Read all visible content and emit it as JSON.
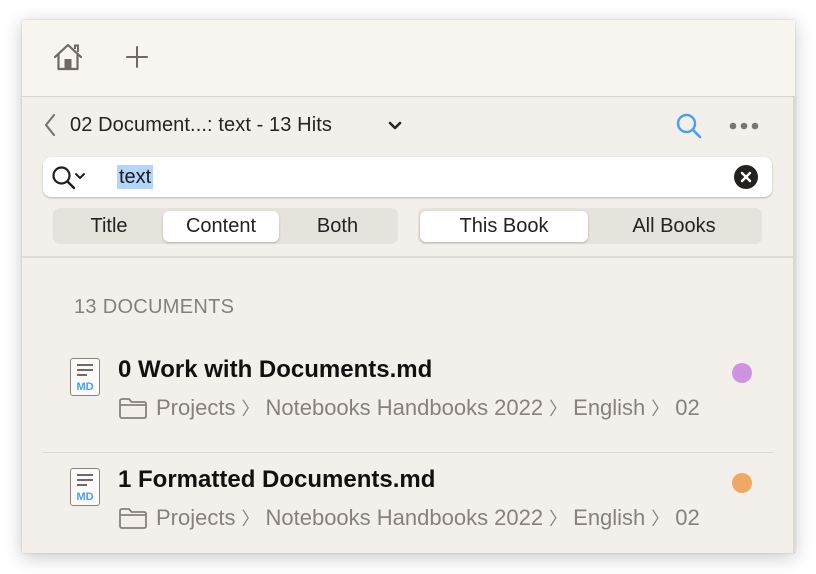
{
  "toolbar": {
    "home_icon": "home-icon",
    "add_icon": "plus-icon"
  },
  "nav": {
    "back_icon": "chevron-left-icon",
    "title": "02 Document...: text - 13 Hits",
    "dropdown_icon": "chevron-down-icon",
    "search_icon": "search-icon",
    "more_icon": "ellipsis-icon"
  },
  "search": {
    "value": "text",
    "placeholder": "",
    "scope_icon": "search-options-icon",
    "clear_icon": "clear-circle-icon"
  },
  "filters": {
    "field": {
      "options": [
        "Title",
        "Content",
        "Both"
      ],
      "selected": "Content"
    },
    "scope": {
      "options": [
        "This Book",
        "All Books"
      ],
      "selected": "This Book"
    }
  },
  "results": {
    "count_label": "13 DOCUMENTS",
    "items": [
      {
        "title": "0 Work with Documents.md",
        "file_type": "MD",
        "path": [
          "Projects",
          "Notebooks Handbooks 2022",
          "English",
          "02"
        ],
        "tag_color": "#cf94e0"
      },
      {
        "title": "1 Formatted Documents.md",
        "file_type": "MD",
        "path": [
          "Projects",
          "Notebooks Handbooks 2022",
          "English",
          "02"
        ],
        "tag_color": "#f0a865"
      }
    ]
  },
  "colors": {
    "accent": "#4a9ff0",
    "selection": "#b3d4fb"
  }
}
